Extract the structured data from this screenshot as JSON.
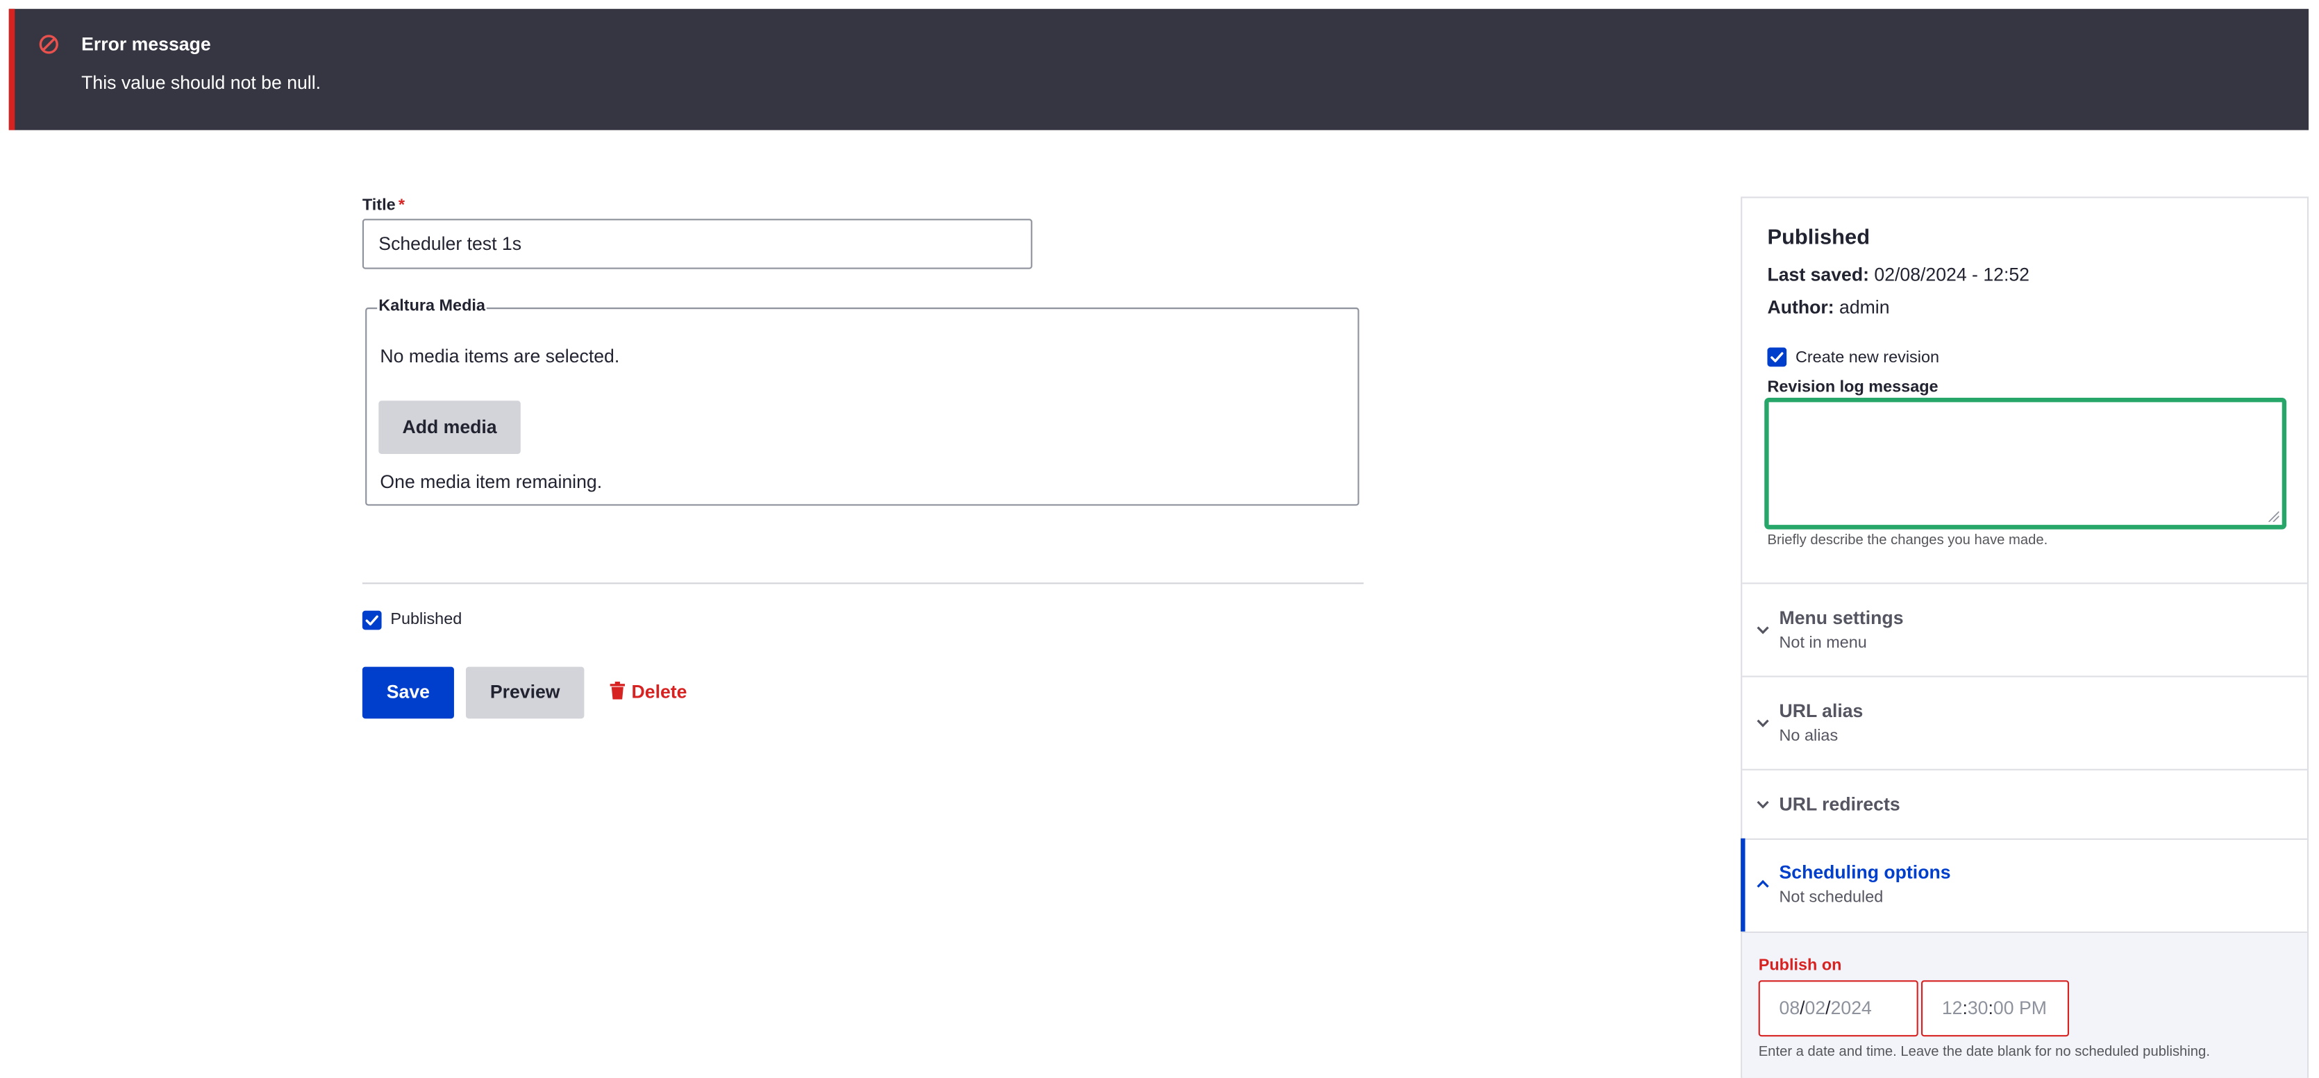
{
  "error": {
    "title": "Error message",
    "text": "This value should not be null."
  },
  "form": {
    "title_label": "Title",
    "required_mark": "*",
    "title_value": "Scheduler test 1s",
    "kaltura": {
      "legend": "Kaltura Media",
      "empty_text": "No media items are selected.",
      "add_button": "Add media",
      "remaining_text": "One media item remaining."
    },
    "published_label": "Published",
    "published_checked": true,
    "actions": {
      "save": "Save",
      "preview": "Preview",
      "delete": "Delete"
    }
  },
  "sidebar": {
    "status": "Published",
    "last_saved_label": "Last saved:",
    "last_saved_value": "02/08/2024 - 12:52",
    "author_label": "Author:",
    "author_value": "admin",
    "create_revision_label": "Create new revision",
    "create_revision_checked": true,
    "revision_log_label": "Revision log message",
    "revision_log_value": "",
    "revision_log_help": "Briefly describe the changes you have made.",
    "accordions": [
      {
        "title": "Menu settings",
        "summary": "Not in menu",
        "expanded": false
      },
      {
        "title": "URL alias",
        "summary": "No alias",
        "expanded": false
      },
      {
        "title": "URL redirects",
        "summary": "",
        "expanded": false
      },
      {
        "title": "Scheduling options",
        "summary": "Not scheduled",
        "expanded": true
      }
    ],
    "scheduling": {
      "publish_on_label": "Publish on",
      "date": {
        "month": "08",
        "day": "02",
        "year": "2024",
        "sep": "/"
      },
      "time": {
        "hour": "12",
        "minute": "30",
        "second": "00",
        "ampm": "PM",
        "sep": ":"
      },
      "help": "Enter a date and time. Leave the date blank for no scheduled publishing."
    }
  },
  "colors": {
    "banner_bg": "#353641",
    "error_red": "#d72222",
    "primary_blue": "#003ecc",
    "focus_green": "#26a769",
    "button_grey": "#d3d4d9"
  }
}
